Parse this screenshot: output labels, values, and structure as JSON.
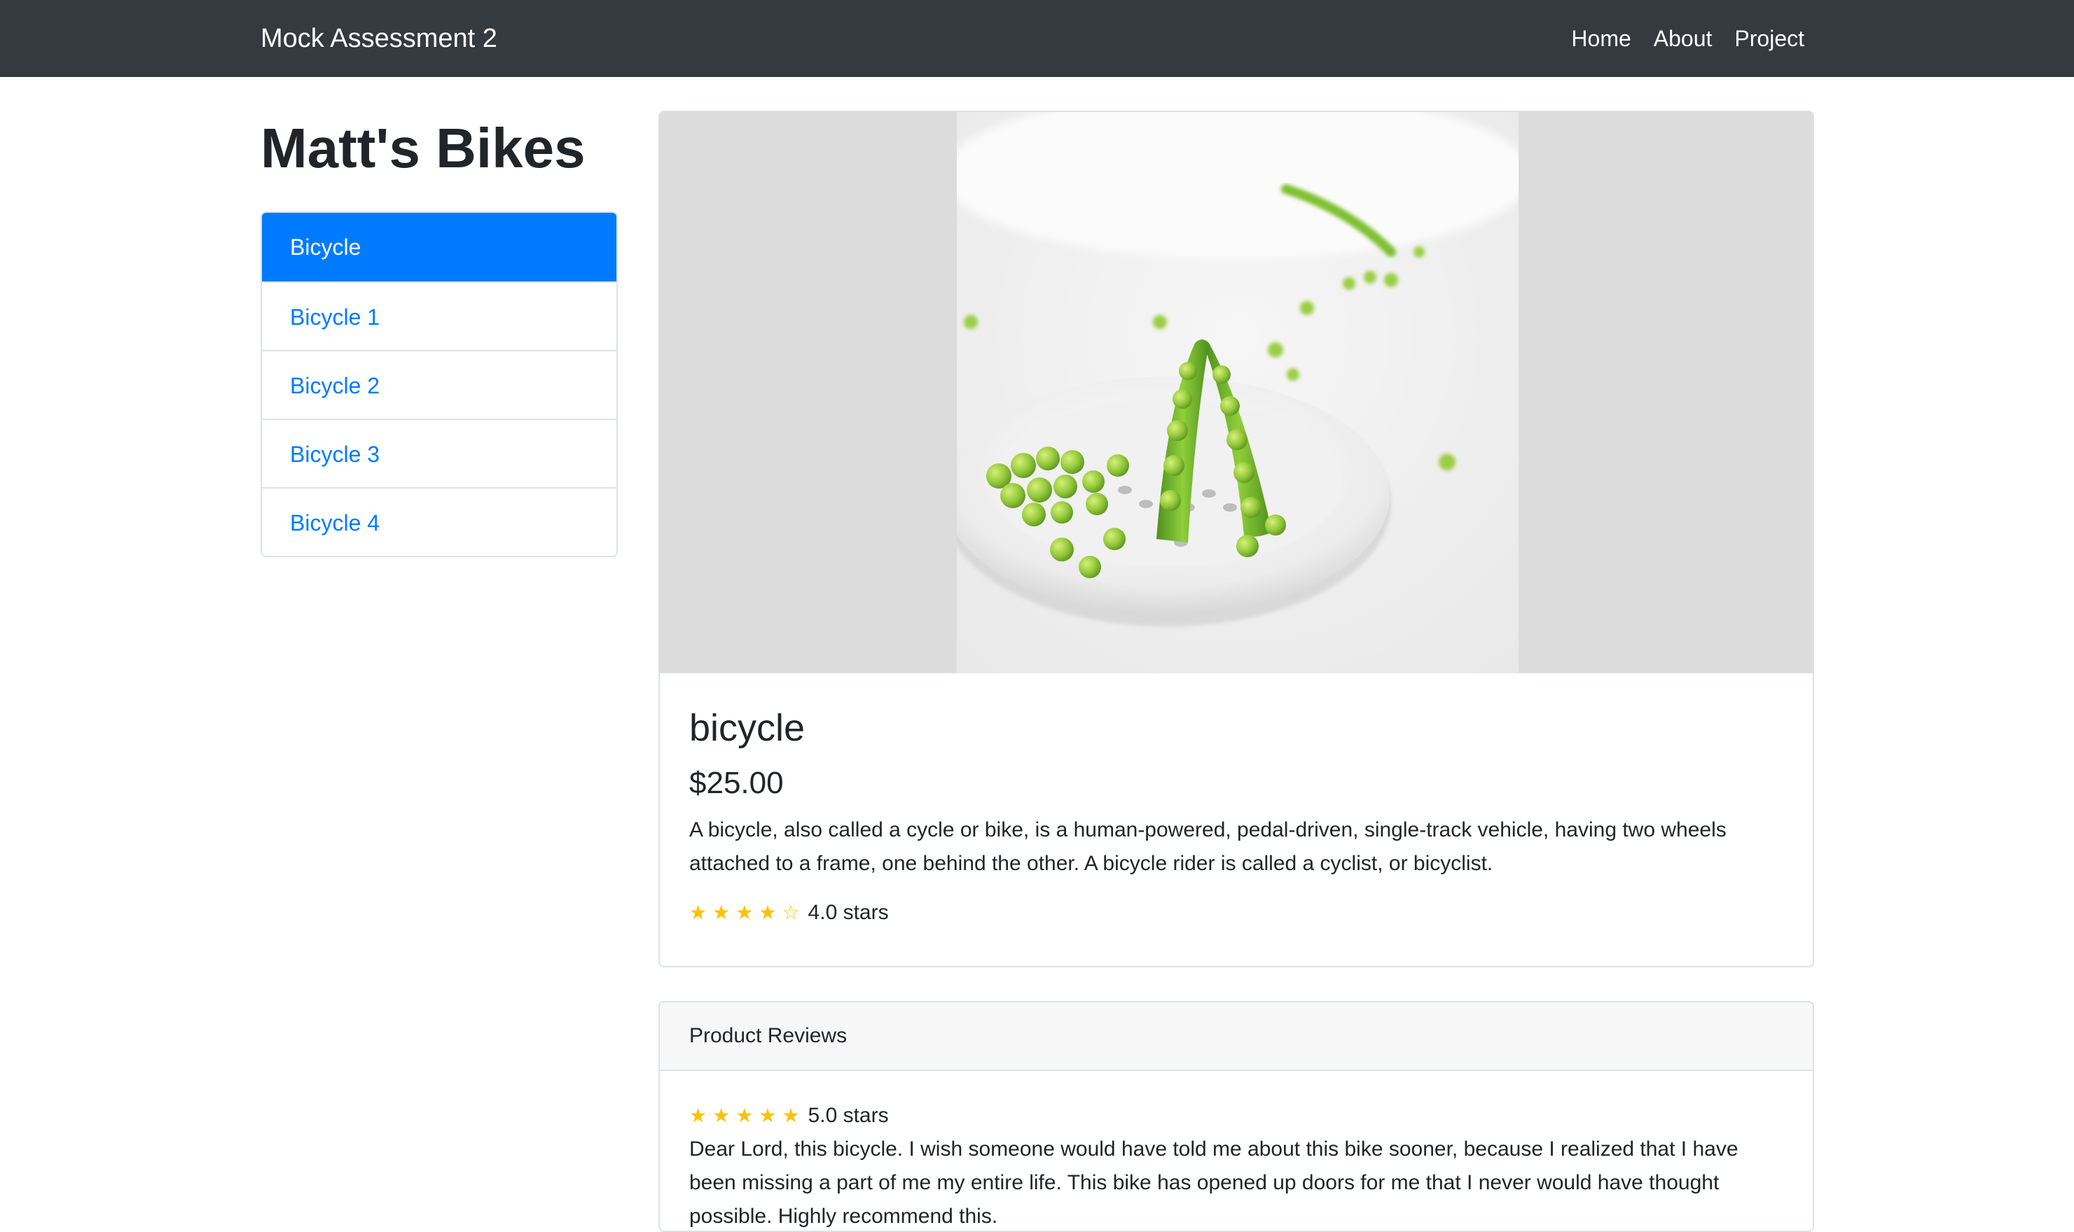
{
  "navbar": {
    "brand": "Mock Assessment 2",
    "links": [
      "Home",
      "About",
      "Project"
    ]
  },
  "sidebar": {
    "title": "Matt's Bikes",
    "items": [
      {
        "label": "Bicycle",
        "active": true
      },
      {
        "label": "Bicycle 1",
        "active": false
      },
      {
        "label": "Bicycle 2",
        "active": false
      },
      {
        "label": "Bicycle 3",
        "active": false
      },
      {
        "label": "Bicycle 4",
        "active": false
      }
    ]
  },
  "product": {
    "image_subject": "green peas in a white ceramic dish",
    "name": "bicycle",
    "price": "$25.00",
    "description": "A bicycle, also called a cycle or bike, is a human-powered, pedal-driven, single-track vehicle, having two wheels attached to a frame, one behind the other. A bicycle rider is called a cyclist, or bicyclist.",
    "rating": 4,
    "rating_max": 5,
    "rating_text": "4.0 stars"
  },
  "reviews": {
    "header": "Product Reviews",
    "items": [
      {
        "rating": 5,
        "rating_max": 5,
        "rating_text": "5.0 stars",
        "text": "Dear Lord, this bicycle. I wish someone would have told me about this bike sooner, because I realized that I have been missing a part of me my entire life. This bike has opened up doors for me that I never would have thought possible. Highly recommend this."
      }
    ]
  },
  "colors": {
    "navbar_bg": "#343a40",
    "primary": "#007bff",
    "star": "#ffc107",
    "image_bg": "#dcdcdc"
  },
  "icons": {
    "star_filled": "★",
    "star_empty": "☆"
  }
}
